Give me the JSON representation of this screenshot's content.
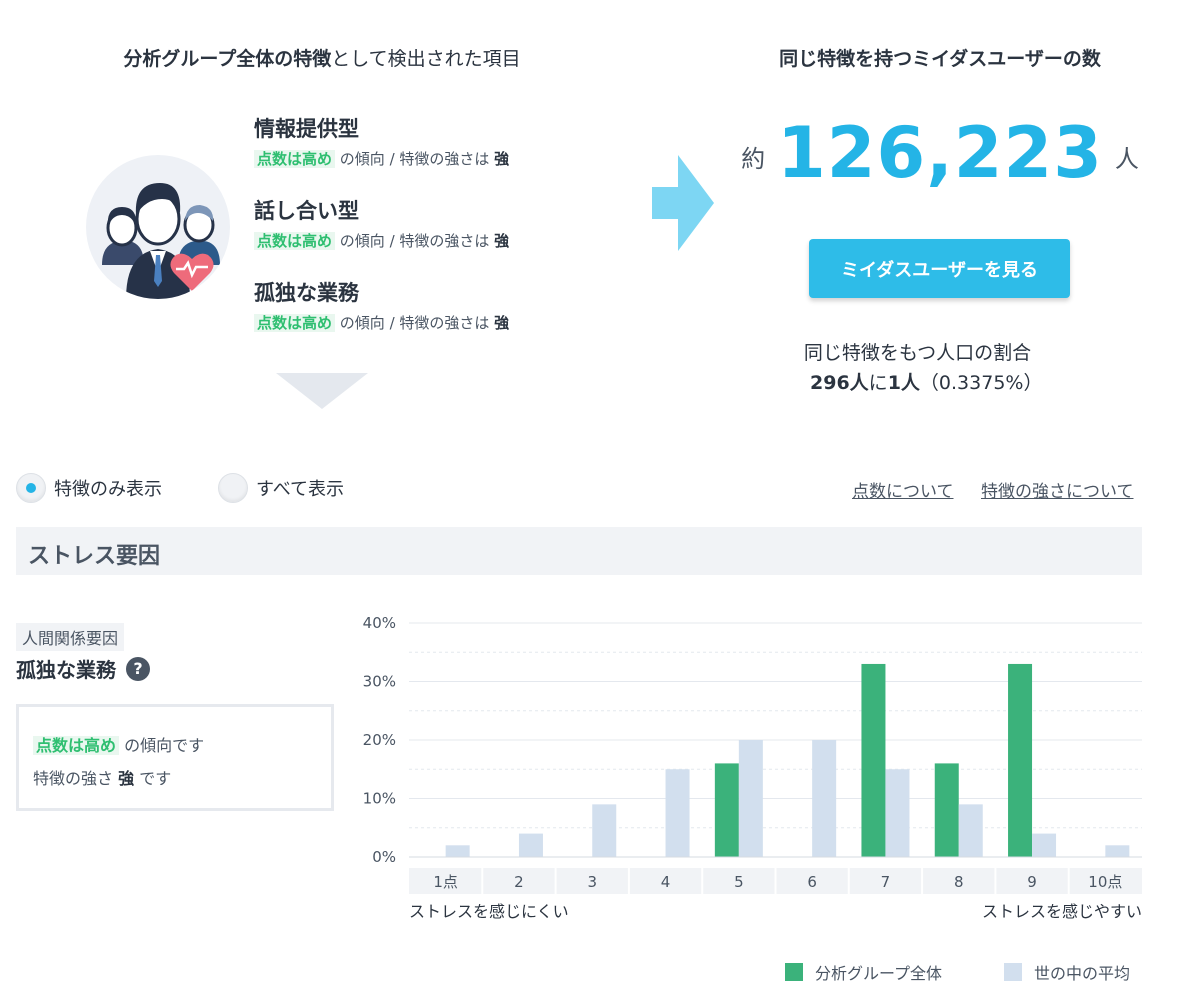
{
  "header": {
    "left_title_bold": "分析グループ全体の特徴",
    "left_title_rest": "として検出された項目",
    "right_title": "同じ特徴を持つミイダスユーザーの数"
  },
  "features": [
    {
      "name": "情報提供型",
      "tag": "点数は高め",
      "desc_mid": "の傾向 / 特徴の強さは",
      "strength": "強"
    },
    {
      "name": "話し合い型",
      "tag": "点数は高め",
      "desc_mid": "の傾向 / 特徴の強さは",
      "strength": "強"
    },
    {
      "name": "孤独な業務",
      "tag": "点数は高め",
      "desc_mid": "の傾向 / 特徴の強さは",
      "strength": "強"
    }
  ],
  "count": {
    "prefix": "約",
    "value": "126,223",
    "unit": "人"
  },
  "view_button_label": "ミイダスユーザーを見る",
  "ratio": {
    "label": "同じ特徴をもつ人口の割合",
    "bold_a": "296人",
    "mid": "に",
    "bold_b": "1人",
    "pct": "（0.3375%）"
  },
  "filters": {
    "features_only": "特徴のみ表示",
    "show_all": "すべて表示",
    "selected": "features_only"
  },
  "links": {
    "about_score": "点数について",
    "about_strength": "特徴の強さについて"
  },
  "section_title": "ストレス要因",
  "factor": {
    "category": "人間関係要因",
    "title": "孤独な業務",
    "help": "?",
    "tag": "点数は高め",
    "line1_rest": "の傾向です",
    "line2_pre": "特徴の強さ",
    "line2_strength": "強",
    "line2_post": "です"
  },
  "colors": {
    "accent_blue": "#24b4e6",
    "group_green": "#3bb27b",
    "average_blue": "#d2dfee"
  },
  "chart_data": {
    "type": "bar",
    "categories": [
      "1点",
      "2",
      "3",
      "4",
      "5",
      "6",
      "7",
      "8",
      "9",
      "10点"
    ],
    "series": [
      {
        "name": "分析グループ全体",
        "values": [
          0,
          0,
          0,
          0,
          16,
          0,
          33,
          16,
          33,
          0
        ]
      },
      {
        "name": "世の中の平均",
        "values": [
          2,
          4,
          9,
          15,
          20,
          20,
          15,
          9,
          4,
          2
        ]
      }
    ],
    "y_ticks": [
      "0%",
      "10%",
      "20%",
      "30%",
      "40%"
    ],
    "ylim": [
      0,
      40
    ],
    "x_left_label": "ストレスを感じにくい",
    "x_right_label": "ストレスを感じやすい",
    "grid": true,
    "legend": "bottom-right"
  }
}
